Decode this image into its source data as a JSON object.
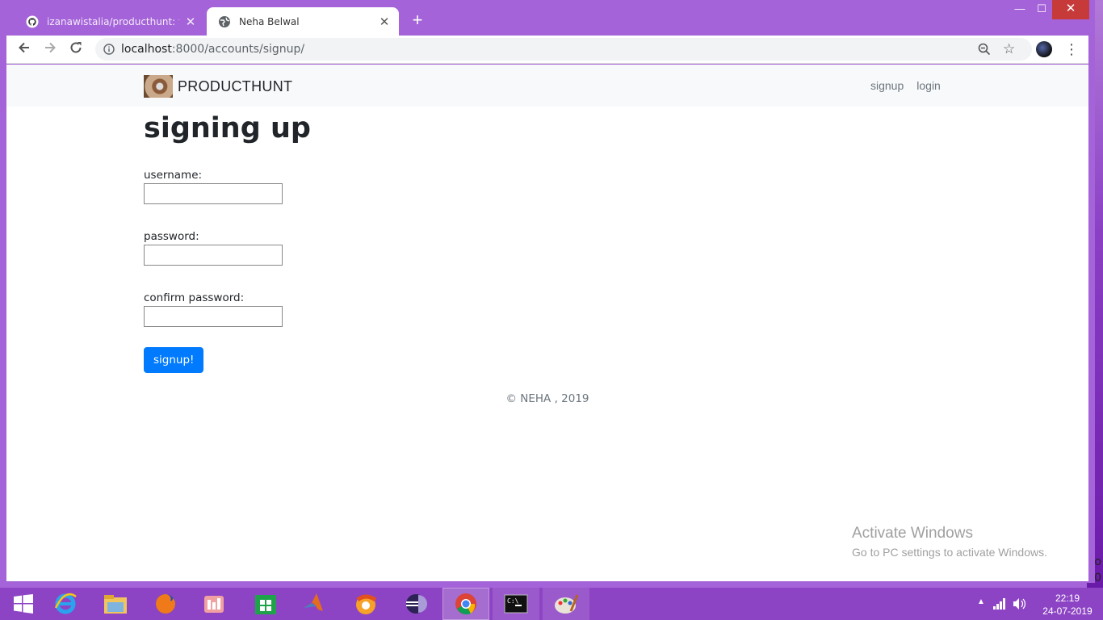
{
  "browser": {
    "tabs": [
      {
        "title": "izanawistalia/producthunt: this is",
        "active": false,
        "icon": "github-icon"
      },
      {
        "title": "Neha Belwal",
        "active": true,
        "icon": "globe-icon"
      }
    ],
    "new_tab_label": "+",
    "url_host": "localhost",
    "url_rest": ":8000/accounts/signup/",
    "controls": {
      "minimize": "—",
      "maximize": "☐",
      "close": "✕"
    }
  },
  "site": {
    "brand": "PRODUCTHUNT",
    "nav": {
      "signup": "signup",
      "login": "login"
    }
  },
  "form": {
    "title": "signing up",
    "username_label": "username:",
    "password_label": "password:",
    "confirm_label": "confirm password:",
    "username_value": "",
    "password_value": "",
    "confirm_value": "",
    "submit_label": "signup!"
  },
  "footer": {
    "text": "© NEHA , 2019"
  },
  "watermark": {
    "title": "Activate Windows",
    "subtitle": "Go to PC settings to activate Windows."
  },
  "taskbar": {
    "time": "22:19",
    "date": "24-07-2019",
    "apps": [
      "windows-start-icon",
      "internet-explorer-icon",
      "file-explorer-icon",
      "firefox-icon",
      "app-icon",
      "windows-store-icon",
      "matlab-icon",
      "brave-icon",
      "eclipse-icon",
      "chrome-icon",
      "command-prompt-icon",
      "paint-icon"
    ]
  },
  "colors": {
    "accent": "#007bff",
    "window_frame": "#a463d8",
    "taskbar": "#8d44c4"
  }
}
